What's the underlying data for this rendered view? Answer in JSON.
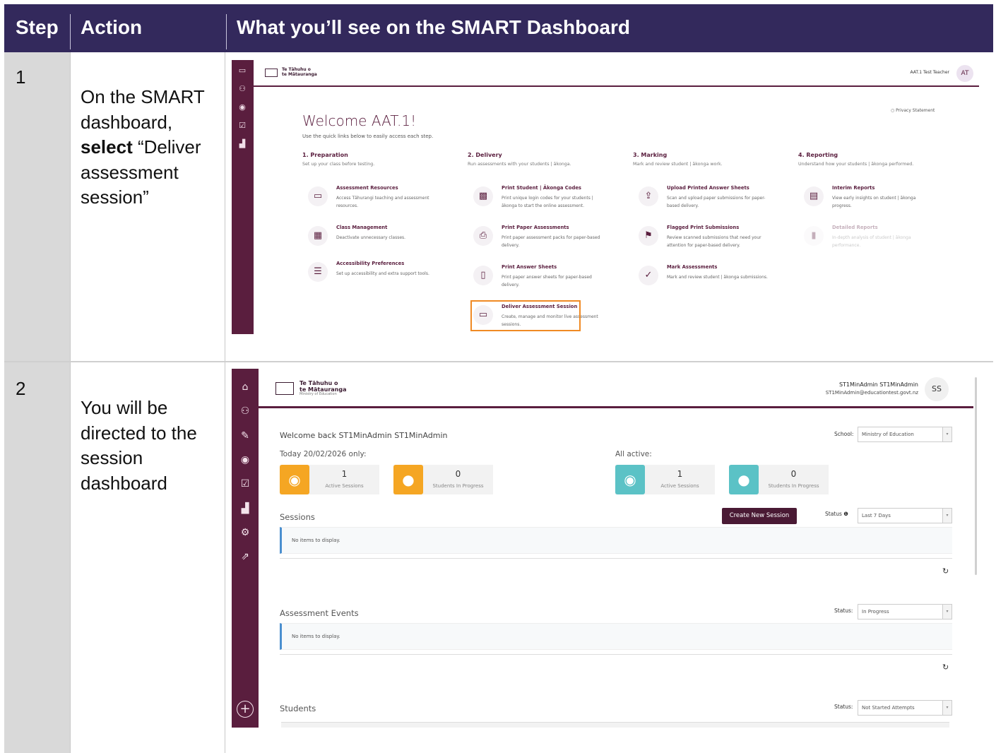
{
  "header": {
    "step": "Step",
    "action": "Action",
    "what": "What you’ll see on the SMART Dashboard"
  },
  "rows": [
    {
      "step": "1",
      "action_pre": "On the SMART dashboard, ",
      "action_bold": "select",
      "action_post": " “Deliver assessment session”"
    },
    {
      "step": "2",
      "action": "You will be directed to the session dashboard"
    }
  ],
  "s1": {
    "brand_line1": "Te Tāhuhu o",
    "brand_line2": "te Mātauranga",
    "user": "AAT.1 Test Teacher",
    "avatar": "AT",
    "privacy": "Privacy Statement",
    "welcome": "Welcome AAT.1!",
    "sub": "Use the quick links below to easily access each step.",
    "columns": [
      {
        "title": "1. Preparation",
        "sub": "Set up your class before testing."
      },
      {
        "title": "2. Delivery",
        "sub": "Run assessments with your students | ākonga."
      },
      {
        "title": "3. Marking",
        "sub": "Mark and review student | ākonga work."
      },
      {
        "title": "4. Reporting",
        "sub": "Understand how your students | ākonga performed."
      }
    ],
    "items": [
      {
        "title": "Assessment Resources",
        "desc": "Access Tāhurangi teaching and assessment resources."
      },
      {
        "title": "Class Management",
        "desc": "Deactivate unnecessary classes."
      },
      {
        "title": "Accessibility Preferences",
        "desc": "Set up accessibility and extra support tools."
      },
      {
        "title": "Print Student | Ākonga Codes",
        "desc": "Print unique login codes for your students | ākonga to start the online assessment."
      },
      {
        "title": "Print Paper Assessments",
        "desc": "Print paper assessment packs for paper-based delivery."
      },
      {
        "title": "Print Answer Sheets",
        "desc": "Print paper answer sheets for paper-based delivery."
      },
      {
        "title": "Deliver Assessment Session",
        "desc": "Create, manage and monitor live assessment sessions."
      },
      {
        "title": "Upload Printed Answer Sheets",
        "desc": "Scan and upload paper submissions for paper-based delivery."
      },
      {
        "title": "Flagged Print Submissions",
        "desc": "Review scanned submissions that need your attention for paper-based delivery."
      },
      {
        "title": "Mark Assessments",
        "desc": "Mark and review student | ākonga submissions."
      },
      {
        "title": "Interim Reports",
        "desc": "View early insights on student | ākonga progress."
      },
      {
        "title": "Detailed Reports",
        "desc": "In-depth analysis of student | ākonga performance."
      }
    ]
  },
  "s2": {
    "brand_line1": "Te Tāhuhu o",
    "brand_line2": "te Mātauranga",
    "brand_sub": "Ministry of Education",
    "user_name": "ST1MinAdmin ST1MinAdmin",
    "user_email": "ST1MinAdmin@educationtest.govt.nz",
    "avatar": "SS",
    "welcome": "Welcome back ST1MinAdmin ST1MinAdmin",
    "school_label": "School:",
    "school_value": "Ministry of Education",
    "today_label": "Today 20/02/2026 only:",
    "all_label": "All active:",
    "cards": [
      {
        "num": "1",
        "cap": "Active Sessions"
      },
      {
        "num": "0",
        "cap": "Students In Progress"
      },
      {
        "num": "1",
        "cap": "Active Sessions"
      },
      {
        "num": "0",
        "cap": "Students In Progress"
      }
    ],
    "sessions_heading": "Sessions",
    "create_button": "Create New Session",
    "status_label": "Status",
    "status_value": "Last 7 Days",
    "no_items": "No items to display.",
    "events_heading": "Assessment Events",
    "events_status_label": "Status:",
    "events_status_value": "In Progress",
    "students_heading": "Students",
    "students_status_label": "Status:",
    "students_status_value": "Not Started Attempts",
    "colors": {
      "orange": "#f5a623",
      "teal": "#5bc2c6",
      "plum": "#5a1e3e"
    }
  }
}
